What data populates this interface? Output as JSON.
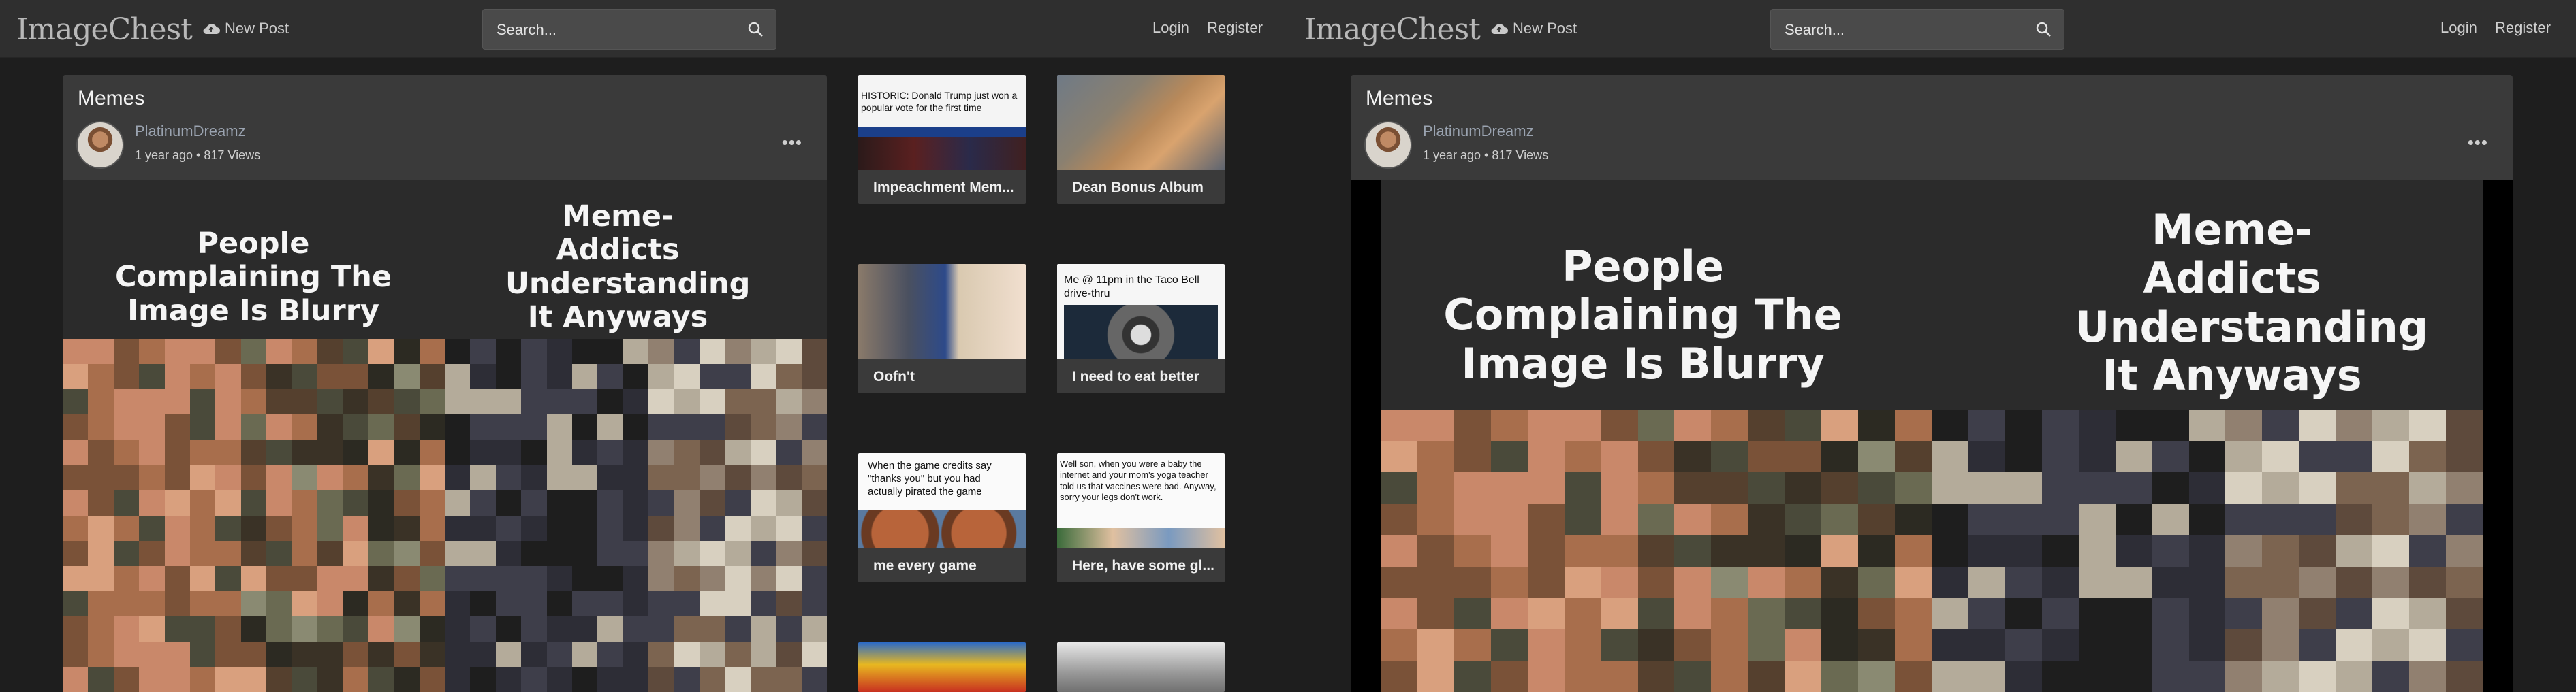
{
  "nav": {
    "logo": "ImageChest",
    "new_post": "New Post",
    "search_placeholder": "Search...",
    "login": "Login",
    "register": "Register"
  },
  "post": {
    "title": "Memes",
    "author": "PlatinumDreamz",
    "meta": "1 year ago • 817 Views",
    "more": "•••",
    "image_caption_left": "People Complaining The Image Is Blurry",
    "image_caption_right": "Meme-Addicts Understanding It Anyways"
  },
  "related": [
    {
      "label": "Impeachment Mem...",
      "thumb_text": "HISTORIC: Donald Trump just won a popular vote for the first time"
    },
    {
      "label": "Dean Bonus Album",
      "thumb_text": ""
    },
    {
      "label": "Oofn't",
      "thumb_text": ""
    },
    {
      "label": "I need to eat better",
      "thumb_text": "Me @ 11pm in the Taco Bell drive-thru"
    },
    {
      "label": "me every game",
      "thumb_text": "When the game credits say \"thanks you\" but you had actually pirated the game"
    },
    {
      "label": "Here, have some gl...",
      "thumb_text": "Well son, when you were a baby the internet and your mom's yoga teacher told us that vaccines were bad. Anyway, sorry your legs don't work."
    }
  ],
  "colors": {
    "nav_bg": "#2f2f2f",
    "page_bg": "#1e1e1e",
    "panel_bg": "#3a3a3a",
    "author_color": "#9aa3b0"
  }
}
